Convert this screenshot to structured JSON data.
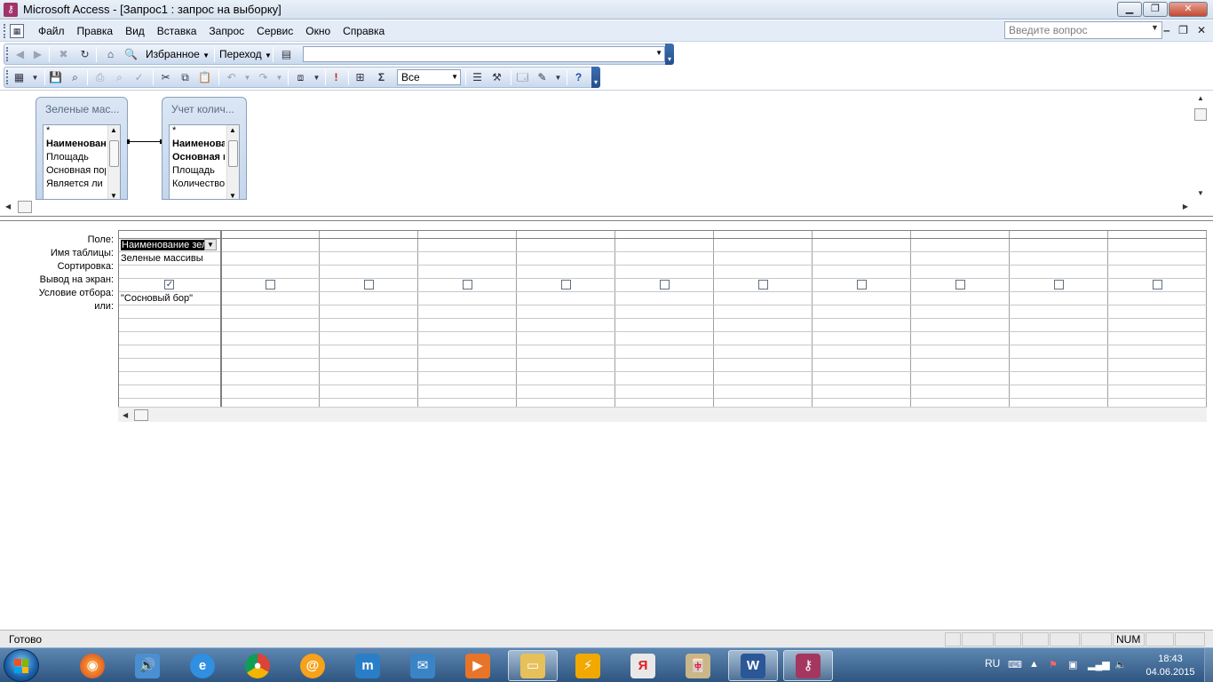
{
  "window": {
    "title": "Microsoft Access - [Запрос1 : запрос на выборку]",
    "min_icon": "minimize-icon",
    "max_icon": "restore-icon",
    "close_icon": "close-icon"
  },
  "menu": {
    "items": [
      "Файл",
      "Правка",
      "Вид",
      "Вставка",
      "Запрос",
      "Сервис",
      "Окно",
      "Справка"
    ],
    "ask_placeholder": "Введите вопрос"
  },
  "toolbar1": {
    "favorites_label": "Избранное",
    "goto_label": "Переход",
    "address_value": ""
  },
  "toolbar2": {
    "sigma_label": "Σ",
    "topvalues_value": "Все"
  },
  "tables": [
    {
      "title": "Зеленые мас...",
      "fields": [
        "*",
        "Наименование",
        "Площадь",
        "Основная пор",
        "Является ли"
      ]
    },
    {
      "title": "Учет колич...",
      "fields": [
        "*",
        "Наименование",
        "Основная п",
        "Площадь",
        "Количество"
      ]
    }
  ],
  "grid": {
    "row_labels": [
      "Поле:",
      "Имя таблицы:",
      "Сортировка:",
      "Вывод на экран:",
      "Условие отбора:",
      "или:"
    ],
    "columns": [
      {
        "field": "Наименование зел",
        "table": "Зеленые массивы",
        "sort": "",
        "show": true,
        "criteria": "\"Сосновый бор\"",
        "or": ""
      }
    ],
    "empty_column_count": 10
  },
  "status": {
    "text": "Готово",
    "num": "NUM"
  },
  "taskbar": {
    "apps": [
      "firefox",
      "volume",
      "internet-explorer",
      "chrome",
      "mail-ru-agent",
      "maxthon",
      "mail",
      "media-player",
      "file-explorer",
      "winamp",
      "yandex",
      "mahjong",
      "word",
      "access"
    ],
    "tray_lang": "RU",
    "time": "18:43",
    "date": "04.06.2015"
  }
}
